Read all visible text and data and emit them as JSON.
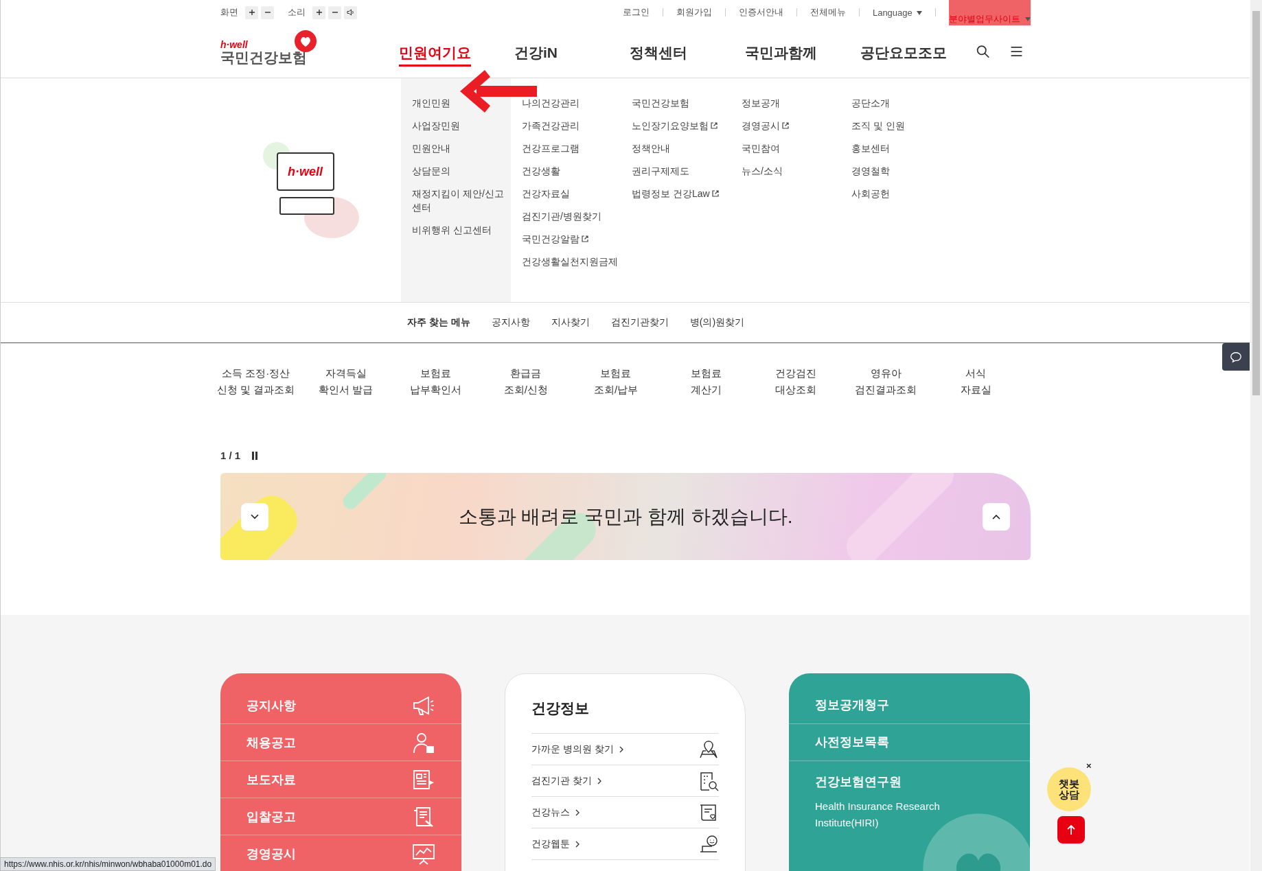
{
  "utility_bar": {
    "screen_label": "화면",
    "sound_label": "소리",
    "links": [
      "로그인",
      "회원가입",
      "인증서안내",
      "전체메뉴"
    ],
    "language": "Language",
    "site_link": "분야별업무사이트"
  },
  "logo": {
    "tagline": "h·well",
    "name": "국민건강보험"
  },
  "nav": [
    {
      "label": "민원여기요",
      "selected": true
    },
    {
      "label": "건강iN",
      "selected": false
    },
    {
      "label": "정책센터",
      "selected": false
    },
    {
      "label": "국민과함께",
      "selected": false
    },
    {
      "label": "공단요모조모",
      "selected": false
    }
  ],
  "mega_menu": {
    "illustration_text": "h·well",
    "columns": [
      {
        "items": [
          {
            "label": "개인민원",
            "external": false
          },
          {
            "label": "사업장민원",
            "external": false
          },
          {
            "label": "민원안내",
            "external": false
          },
          {
            "label": "상담문의",
            "external": false
          },
          {
            "label": "재정지킴이 제안/신고센터",
            "external": false
          },
          {
            "label": "비위행위 신고센터",
            "external": false
          }
        ]
      },
      {
        "items": [
          {
            "label": "나의건강관리",
            "external": false
          },
          {
            "label": "가족건강관리",
            "external": false
          },
          {
            "label": "건강프로그램",
            "external": false
          },
          {
            "label": "건강생활",
            "external": false
          },
          {
            "label": "건강자료실",
            "external": false
          },
          {
            "label": "검진기관/병원찾기",
            "external": false
          },
          {
            "label": "국민건강알람",
            "external": true
          },
          {
            "label": "건강생활실천지원금제",
            "external": false
          }
        ]
      },
      {
        "items": [
          {
            "label": "국민건강보험",
            "external": false
          },
          {
            "label": "노인장기요양보험",
            "external": true
          },
          {
            "label": "정책안내",
            "external": false
          },
          {
            "label": "권리구제제도",
            "external": false
          },
          {
            "label": "법령정보 건강Law",
            "external": true
          }
        ]
      },
      {
        "items": [
          {
            "label": "정보공개",
            "external": false
          },
          {
            "label": "경영공시",
            "external": true
          },
          {
            "label": "국민참여",
            "external": false
          },
          {
            "label": "뉴스/소식",
            "external": false
          }
        ]
      },
      {
        "items": [
          {
            "label": "공단소개",
            "external": false
          },
          {
            "label": "조직 및 인원",
            "external": false
          },
          {
            "label": "홍보센터",
            "external": false
          },
          {
            "label": "경영철학",
            "external": false
          },
          {
            "label": "사회공헌",
            "external": false
          }
        ]
      }
    ]
  },
  "quick_menu": {
    "title": "자주 찾는 메뉴",
    "links": [
      "공지사항",
      "지사찾기",
      "검진기관찾기",
      "병(의)원찾기"
    ]
  },
  "services": [
    {
      "line1": "소득 조정·정산",
      "line2": "신청 및 결과조회"
    },
    {
      "line1": "자격득실",
      "line2": "확인서 발급"
    },
    {
      "line1": "보험료",
      "line2": "납부확인서"
    },
    {
      "line1": "환급금",
      "line2": "조회/신청"
    },
    {
      "line1": "보험료",
      "line2": "조회/납부"
    },
    {
      "line1": "보험료",
      "line2": "계산기"
    },
    {
      "line1": "건강검진",
      "line2": "대상조회"
    },
    {
      "line1": "영유아",
      "line2": "검진결과조회"
    },
    {
      "line1": "서식",
      "line2": "자료실"
    }
  ],
  "slider": {
    "counter": "1 / 1",
    "banner_text": "소통과 배려로 국민과 함께 하겠습니다."
  },
  "notice_card": {
    "items": [
      "공지사항",
      "채용공고",
      "보도자료",
      "입찰공고",
      "경영공시"
    ]
  },
  "health_card": {
    "title": "건강정보",
    "links": [
      "가까운 병의원 찾기",
      "검진기관 찾기",
      "건강뉴스",
      "건강웹툰"
    ]
  },
  "info_card": {
    "links": [
      "정보공개청구",
      "사전정보목록"
    ],
    "institute": {
      "title": "건강보험연구원",
      "subtitle": "Health Insurance Research Institute(HIRI)"
    }
  },
  "chatbot": {
    "label": "챗봇 상담",
    "close": "×"
  },
  "status_bar": {
    "url": "https://www.nhis.or.kr/nhis/minwon/wbhaba01000m01.do"
  }
}
